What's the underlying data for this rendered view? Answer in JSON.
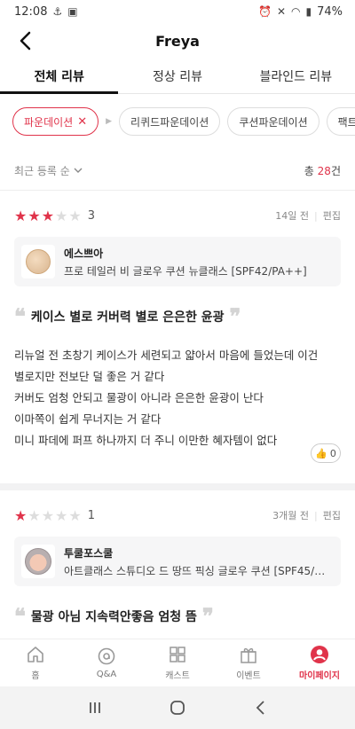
{
  "status": {
    "time": "12:08",
    "battery": "74%"
  },
  "header": {
    "title": "Freya"
  },
  "tabs": [
    {
      "label": "전체 리뷰",
      "active": true
    },
    {
      "label": "정상 리뷰"
    },
    {
      "label": "블라인드 리뷰"
    }
  ],
  "filters": {
    "selected": "파운데이션",
    "others": [
      "리퀴드파운데이션",
      "쿠션파운데이션",
      "팩트파운"
    ]
  },
  "sort": {
    "label": "최근 등록 순",
    "total_prefix": "총",
    "total_count": "28",
    "total_suffix": "건"
  },
  "reviews": [
    {
      "rating": 3,
      "rating_label": "3",
      "date": "14일 전",
      "edit": "편집",
      "brand": "에스쁘아",
      "product": "프로 테일러 비 글로우 쿠션 뉴클래스 [SPF42/PA++]",
      "headline": "케이스 별로 커버력 별로 은은한 윤광",
      "body": [
        "리뉴얼 전 초창기 케이스가 세련되고 얇아서 마음에 들었는데 이건",
        "별로지만 전보단 덜 좋은 거 같다",
        "커버도 엄청 안되고 물광이 아니라 은은한 윤광이 난다",
        "이마쪽이 쉽게 무너지는 거 같다",
        "미니 파데에 퍼프 하나까지 더 주니 이만한 혜자템이 없다"
      ],
      "likes": "0"
    },
    {
      "rating": 1,
      "rating_label": "1",
      "date": "3개월 전",
      "edit": "편집",
      "brand": "투쿨포스쿨",
      "product": "아트클래스 스튜디오 드 땅뜨 픽싱 글로우 쿠션 [SPF45/PA+...",
      "headline": "물광 아님 지속력안좋음 엄청 뜸"
    }
  ],
  "bottom_nav": [
    {
      "label": "홈",
      "icon": "home-icon"
    },
    {
      "label": "Q&A",
      "icon": "qa-icon"
    },
    {
      "label": "캐스트",
      "icon": "grid-icon"
    },
    {
      "label": "이벤트",
      "icon": "gift-icon"
    },
    {
      "label": "마이페이지",
      "icon": "profile-icon",
      "active": true
    }
  ],
  "colors": {
    "accent": "#e0334a"
  }
}
